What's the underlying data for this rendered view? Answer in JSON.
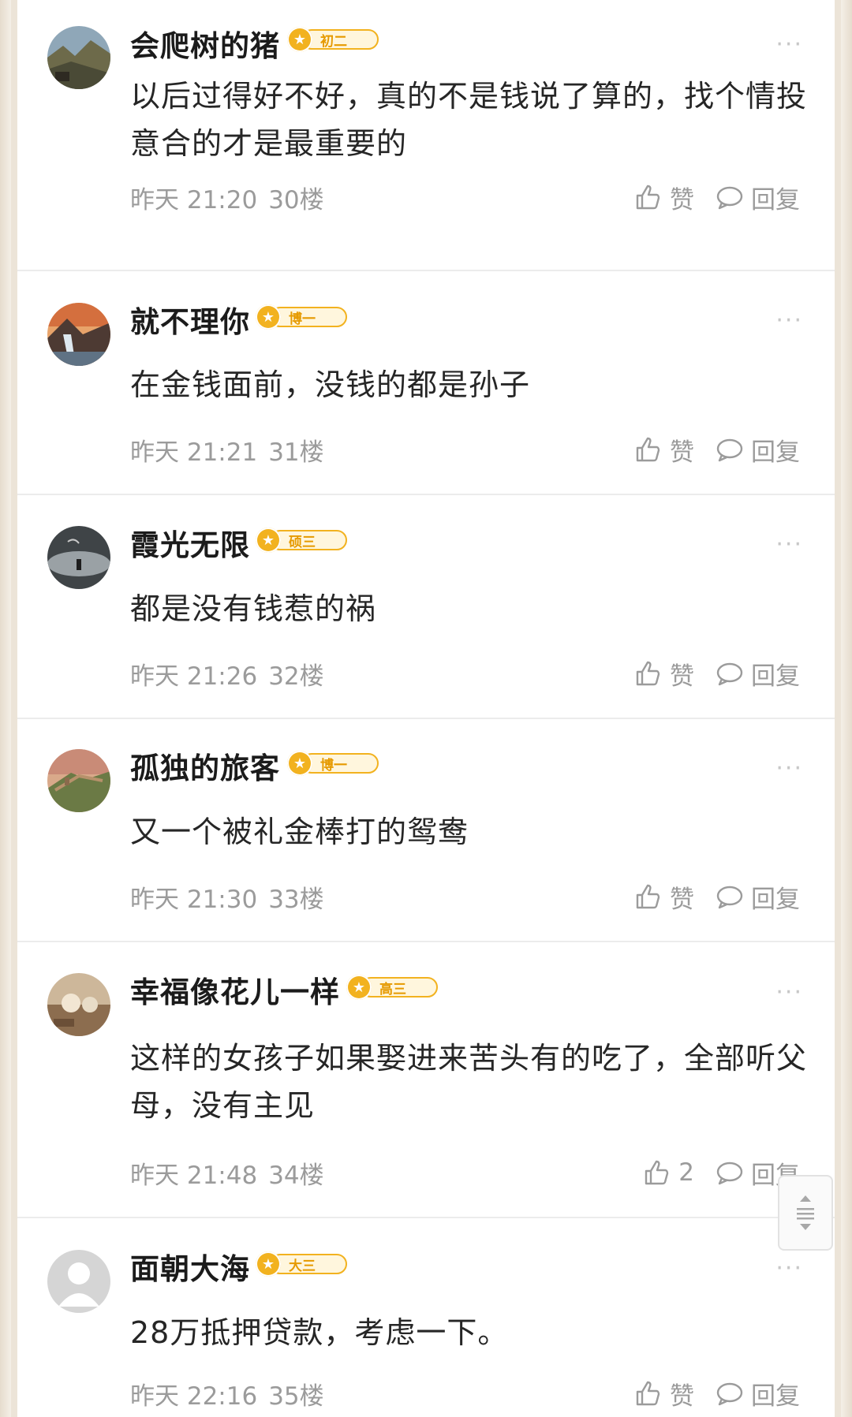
{
  "comments": [
    {
      "username": "会爬树的猪",
      "badge": "初二",
      "content": "以后过得好不好，真的不是钱说了算的，找个情投意合的才是最重要的",
      "time": "昨天 21:20",
      "floor": "30楼",
      "like_label": "赞",
      "reply_label": "回复"
    },
    {
      "username": "就不理你",
      "badge": "博一",
      "content": "在金钱面前，没钱的都是孙子",
      "time": "昨天 21:21",
      "floor": "31楼",
      "like_label": "赞",
      "reply_label": "回复"
    },
    {
      "username": "霞光无限",
      "badge": "硕三",
      "content": "都是没有钱惹的祸",
      "time": "昨天 21:26",
      "floor": "32楼",
      "like_label": "赞",
      "reply_label": "回复"
    },
    {
      "username": "孤独的旅客",
      "badge": "博一",
      "content": "又一个被礼金棒打的鸳鸯",
      "time": "昨天 21:30",
      "floor": "33楼",
      "like_label": "赞",
      "reply_label": "回复"
    },
    {
      "username": "幸福像花儿一样",
      "badge": "高三",
      "content": "这样的女孩子如果娶进来苦头有的吃了，全部听父母，没有主见",
      "time": "昨天 21:48",
      "floor": "34楼",
      "like_label": "2",
      "reply_label": "回复"
    },
    {
      "username": "面朝大海",
      "badge": "大三",
      "content": "28万抵押贷款，考虑一下。",
      "time": "昨天 22:16",
      "floor": "35楼",
      "like_label": "赞",
      "reply_label": "回复"
    }
  ],
  "more_glyph": "···",
  "icons": {
    "like": "thumbs-up-icon",
    "reply": "speech-bubble-icon",
    "more": "more-dots-icon",
    "badge": "medal-icon",
    "scroll": "scroll-to-top-icon"
  },
  "colors": {
    "badge_gold": "#f2b21f",
    "meta_gray": "#9b9b9b",
    "text": "#262626"
  }
}
